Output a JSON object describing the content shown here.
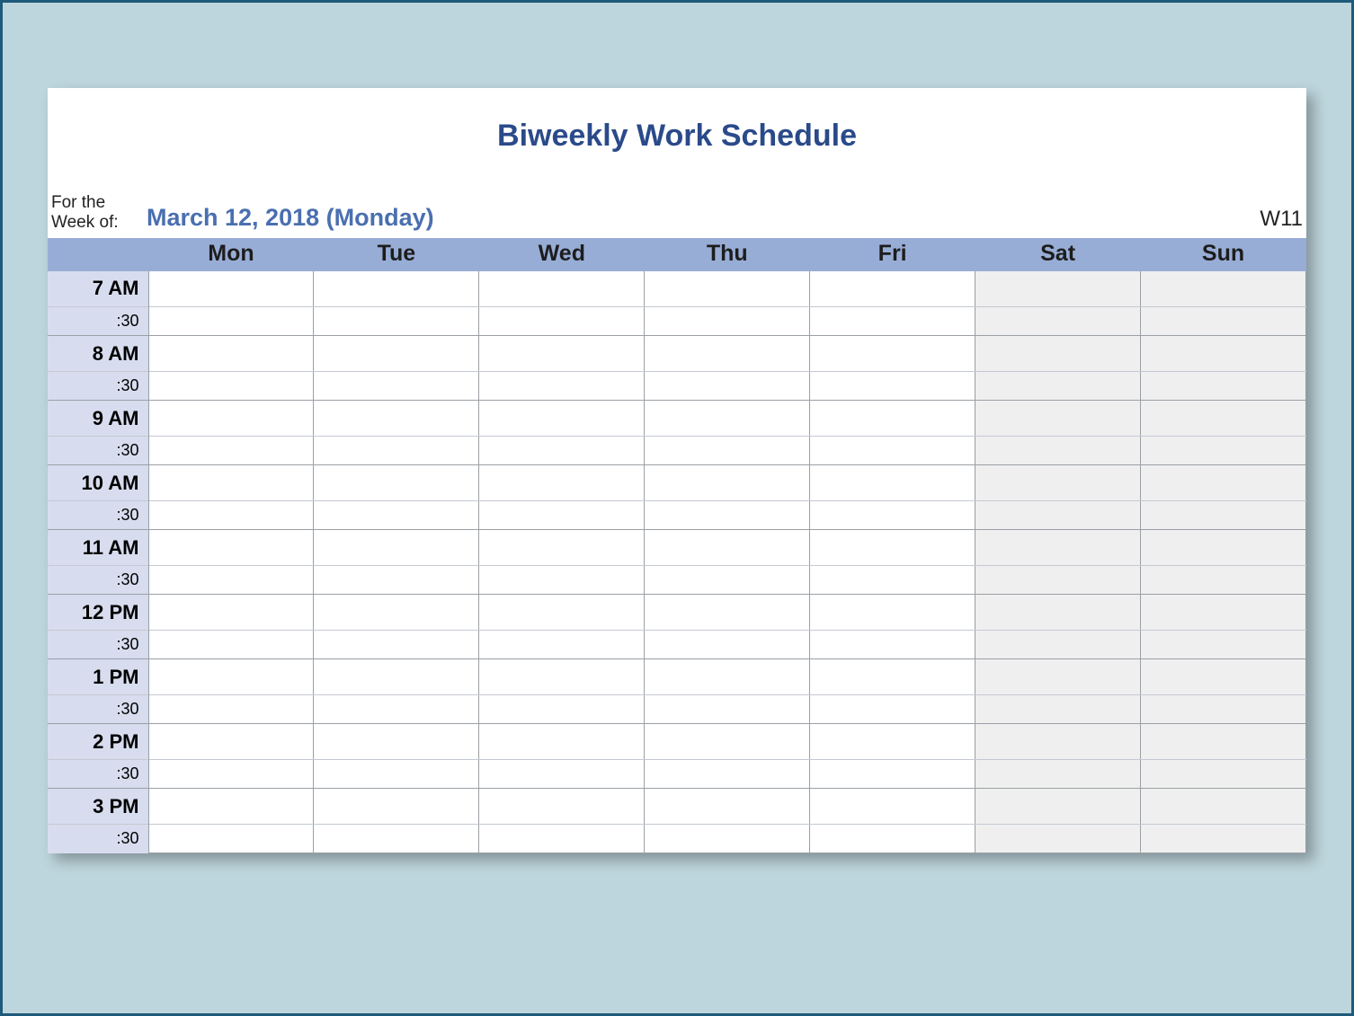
{
  "title": "Biweekly Work Schedule",
  "week_label_line1": "For the",
  "week_label_line2": "Week of:",
  "week_date": "March 12, 2018 (Monday)",
  "week_number": "W11",
  "days": [
    "Mon",
    "Tue",
    "Wed",
    "Thu",
    "Fri",
    "Sat",
    "Sun"
  ],
  "weekend_columns": [
    5,
    6
  ],
  "time_rows": [
    {
      "hour": "7 AM",
      "half": ":30"
    },
    {
      "hour": "8 AM",
      "half": ":30"
    },
    {
      "hour": "9 AM",
      "half": ":30"
    },
    {
      "hour": "10 AM",
      "half": ":30"
    },
    {
      "hour": "11 AM",
      "half": ":30"
    },
    {
      "hour": "12 PM",
      "half": ":30"
    },
    {
      "hour": "1 PM",
      "half": ":30"
    },
    {
      "hour": "2 PM",
      "half": ":30"
    },
    {
      "hour": "3 PM",
      "half": ":30"
    }
  ]
}
